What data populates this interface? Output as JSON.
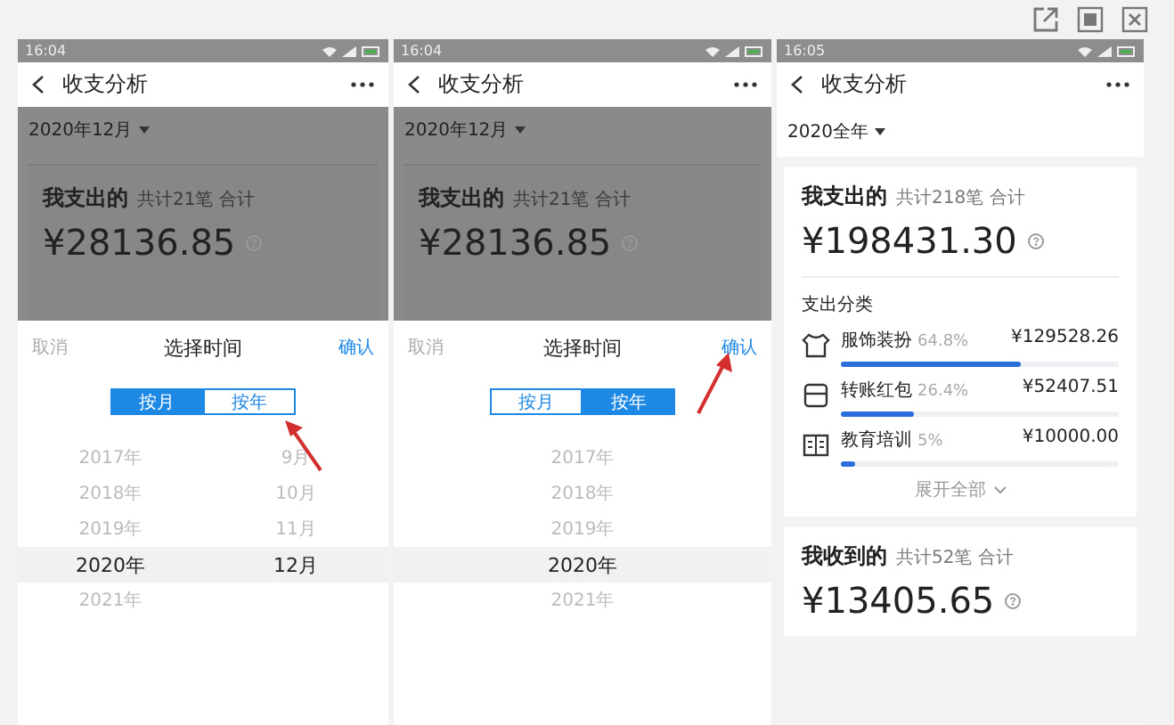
{
  "screens": [
    {
      "kind": "picker",
      "status_bar": {
        "time": "16:04"
      },
      "nav": {
        "title": "收支分析"
      },
      "period": "2020年12月",
      "summary": {
        "title": "我支出的",
        "count": "共计21笔 合计",
        "amount": "¥28136.85"
      },
      "sheet": {
        "cancel": "取消",
        "title": "选择时间",
        "confirm": "确认",
        "modes": [
          {
            "label": "按月",
            "selected": true
          },
          {
            "label": "按年",
            "selected": false
          }
        ],
        "rows": [
          {
            "cells": [
              "2017年",
              "9月"
            ],
            "selected": false
          },
          {
            "cells": [
              "2018年",
              "10月"
            ],
            "selected": false
          },
          {
            "cells": [
              "2019年",
              "11月"
            ],
            "selected": false
          },
          {
            "cells": [
              "2020年",
              "12月"
            ],
            "selected": true
          },
          {
            "cells": [
              "2021年"
            ],
            "selected": false
          }
        ]
      },
      "arrow": {
        "kind": "mode"
      }
    },
    {
      "kind": "picker",
      "status_bar": {
        "time": "16:04"
      },
      "nav": {
        "title": "收支分析"
      },
      "period": "2020年12月",
      "summary": {
        "title": "我支出的",
        "count": "共计21笔 合计",
        "amount": "¥28136.85"
      },
      "sheet": {
        "cancel": "取消",
        "title": "选择时间",
        "confirm": "确认",
        "modes": [
          {
            "label": "按月",
            "selected": false
          },
          {
            "label": "按年",
            "selected": true
          }
        ],
        "rows": [
          {
            "cells": [
              "2017年"
            ],
            "selected": false
          },
          {
            "cells": [
              "2018年"
            ],
            "selected": false
          },
          {
            "cells": [
              "2019年"
            ],
            "selected": false
          },
          {
            "cells": [
              "2020年"
            ],
            "selected": true
          },
          {
            "cells": [
              "2021年"
            ],
            "selected": false
          }
        ]
      },
      "arrow": {
        "kind": "confirm"
      }
    },
    {
      "kind": "report",
      "status_bar": {
        "time": "16:05"
      },
      "nav": {
        "title": "收支分析"
      },
      "period": "2020全年",
      "summary": {
        "title": "我支出的",
        "count": "共计218笔 合计",
        "amount": "¥198431.30"
      },
      "categories_title": "支出分类",
      "categories": [
        {
          "kind": "clothing",
          "name": "服饰装扮",
          "percent": "64.8%",
          "amount": "¥129528.26",
          "level": 0.648
        },
        {
          "kind": "transfer",
          "name": "转账红包",
          "percent": "26.4%",
          "amount": "¥52407.51",
          "level": 0.264
        },
        {
          "kind": "education",
          "name": "教育培训",
          "percent": "5%",
          "amount": "¥10000.00",
          "level": 0.05
        }
      ],
      "expand": "展开全部",
      "income": {
        "title": "我收到的",
        "count": "共计52笔 合计",
        "amount": "¥13405.65"
      }
    }
  ]
}
